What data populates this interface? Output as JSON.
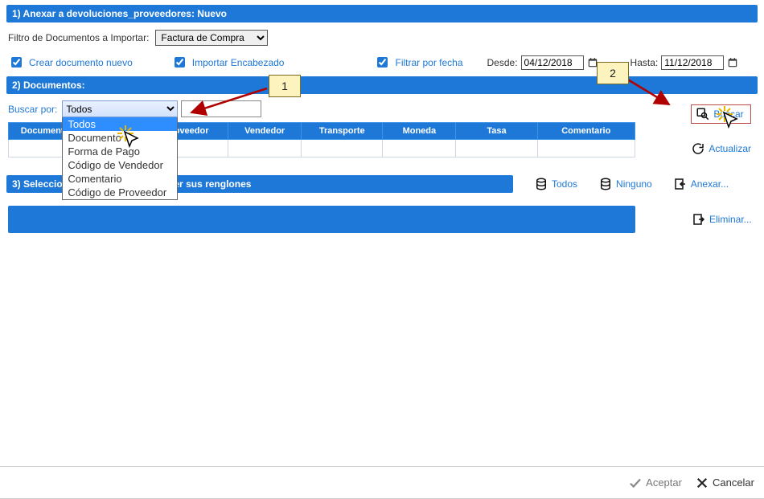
{
  "header": {
    "title": "1) Anexar a devoluciones_proveedores: Nuevo"
  },
  "filter": {
    "label": "Filtro de Documentos a Importar:",
    "selected": "Factura de Compra"
  },
  "options_row": {
    "crear_nuevo": "Crear documento nuevo",
    "importar_encabezado": "Importar Encabezado",
    "filtrar_por_fecha": "Filtrar por fecha",
    "desde_label": "Desde:",
    "desde_value": "04/12/2018",
    "hasta_label": "Hasta:",
    "hasta_value": "11/12/2018"
  },
  "section2": {
    "title": "2) Documentos:"
  },
  "search": {
    "label": "Buscar por:",
    "selected": "Todos",
    "options": [
      "Todos",
      "Documento",
      "Forma de Pago",
      "Código de Vendedor",
      "Comentario",
      "Código de Proveedor"
    ],
    "input_value": ""
  },
  "table": {
    "headers": [
      "Documento",
      "",
      "oveedor",
      "Vendedor",
      "Transporte",
      "Moneda",
      "Tasa",
      "Comentario"
    ]
  },
  "buttons": {
    "buscar": "Buscar",
    "actualizar": "Actualizar",
    "todos": "Todos",
    "ninguno": "Ninguno",
    "anexar": "Anexar...",
    "eliminar": "Eliminar..."
  },
  "section3": {
    "title": "3) Seleccione un documento para ver sus renglones"
  },
  "callouts": {
    "one": "1",
    "two": "2"
  },
  "footer": {
    "aceptar": "Aceptar",
    "cancelar": "Cancelar"
  }
}
